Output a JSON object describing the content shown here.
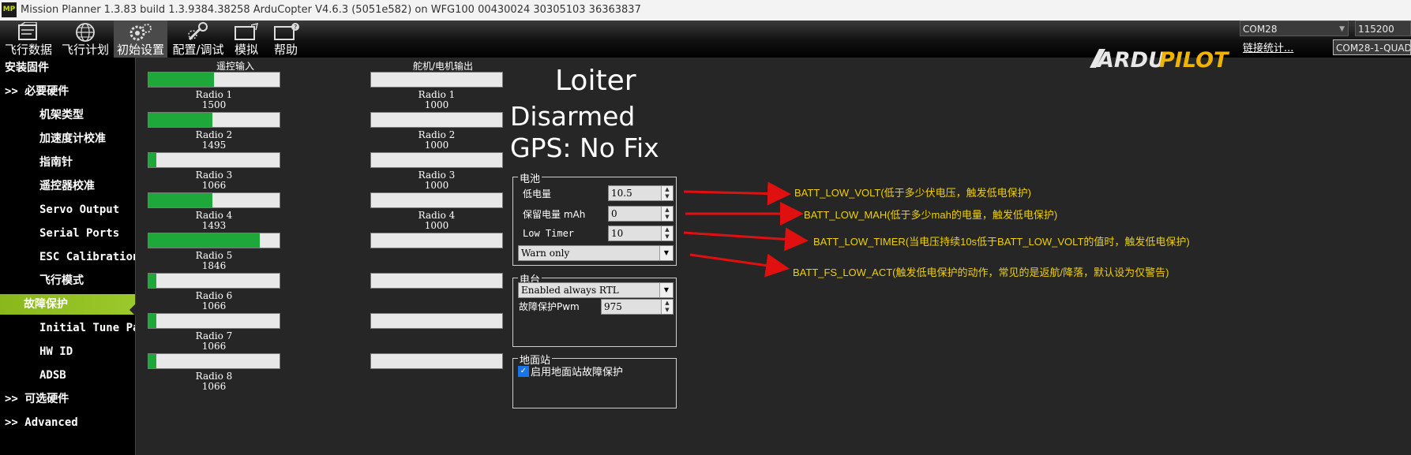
{
  "window": {
    "title": "Mission Planner 1.3.83 build 1.3.9384.38258 ArduCopter V4.6.3 (5051e582) on WFG100 00430024 30305103 36363837",
    "icon_text": "MP"
  },
  "menu": [
    {
      "label": "飞行数据",
      "icon": "flight-data-icon"
    },
    {
      "label": "飞行计划",
      "icon": "globe-icon"
    },
    {
      "label": "初始设置",
      "icon": "setup-gear-icon"
    },
    {
      "label": "配置/调试",
      "icon": "wrench-icon"
    },
    {
      "label": "模拟",
      "icon": "simulation-icon"
    },
    {
      "label": "帮助",
      "icon": "help-icon"
    }
  ],
  "logo": {
    "part1": "ARDU",
    "part2": "PILOT"
  },
  "connection": {
    "port": "COM28",
    "baud": "115200",
    "stats_link": "链接统计...",
    "device": "COM28-1-QUADROTOR"
  },
  "sidebar": {
    "items": [
      {
        "label": "安装固件",
        "indent": 0
      },
      {
        "label": ">> 必要硬件",
        "indent": 0
      },
      {
        "label": "机架类型",
        "indent": 2
      },
      {
        "label": "加速度计校准",
        "indent": 2
      },
      {
        "label": "指南针",
        "indent": 2
      },
      {
        "label": "遥控器校准",
        "indent": 2
      },
      {
        "label": "Servo Output",
        "indent": 2
      },
      {
        "label": "Serial Ports",
        "indent": 2
      },
      {
        "label": "ESC Calibration",
        "indent": 2
      },
      {
        "label": "飞行模式",
        "indent": 2
      },
      {
        "label": "故障保护",
        "indent": 1,
        "active": true
      },
      {
        "label": "Initial Tune Parameters",
        "indent": 2
      },
      {
        "label": "HW ID",
        "indent": 2
      },
      {
        "label": "ADSB",
        "indent": 2
      },
      {
        "label": ">> 可选硬件",
        "indent": 0
      },
      {
        "label": ">> Advanced",
        "indent": 0
      }
    ]
  },
  "rc_input": {
    "title": "遥控输入",
    "channels": [
      {
        "name": "Radio 1",
        "value": "1500",
        "level": 0.5
      },
      {
        "name": "Radio 2",
        "value": "1495",
        "level": 0.49
      },
      {
        "name": "Radio 3",
        "value": "1066",
        "level": 0.06
      },
      {
        "name": "Radio 4",
        "value": "1493",
        "level": 0.49
      },
      {
        "name": "Radio 5",
        "value": "1846",
        "level": 0.85
      },
      {
        "name": "Radio 6",
        "value": "1066",
        "level": 0.06
      },
      {
        "name": "Radio 7",
        "value": "1066",
        "level": 0.06
      },
      {
        "name": "Radio 8",
        "value": "1066",
        "level": 0.06
      }
    ]
  },
  "servo_output": {
    "title": "舵机/电机输出",
    "channels": [
      {
        "name": "Radio 1",
        "value": "1000",
        "level": 0
      },
      {
        "name": "Radio 2",
        "value": "1000",
        "level": 0
      },
      {
        "name": "Radio 3",
        "value": "1000",
        "level": 0
      },
      {
        "name": "Radio 4",
        "value": "1000",
        "level": 0
      },
      {
        "level": 0
      },
      {
        "level": 0
      },
      {
        "level": 0
      },
      {
        "level": 0
      }
    ]
  },
  "status": {
    "mode": "Loiter",
    "armed": "Disarmed",
    "gps": "GPS: No Fix"
  },
  "battery": {
    "title": "电池",
    "low_voltage_label": "低电量",
    "low_voltage_value": "10.5",
    "reserve_mah_label": "保留电量 mAh",
    "reserve_mah_value": "0",
    "low_timer_label": "Low Timer",
    "low_timer_value": "10",
    "action_value": "Warn only"
  },
  "radio": {
    "title": "电台",
    "action_value": "Enabled always RTL",
    "pwm_label": "故障保护Pwm",
    "pwm_value": "975"
  },
  "gcs": {
    "title": "地面站",
    "checkbox_label": "启用地面站故障保护",
    "checked": true
  },
  "annotations": {
    "color": "#f0d000",
    "arrow_color": "#e01010",
    "items": [
      "BATT_LOW_VOLT(低于多少伏电压，触发低电保护)",
      "BATT_LOW_MAH(低于多少mah的电量，触发低电保护)",
      "BATT_LOW_TIMER(当电压持续10s低于BATT_LOW_VOLT的值时，触发低电保护)",
      "BATT_FS_LOW_ACT(触发低电保护的动作，常见的是返航/降落，默认设为仅警告)"
    ]
  }
}
